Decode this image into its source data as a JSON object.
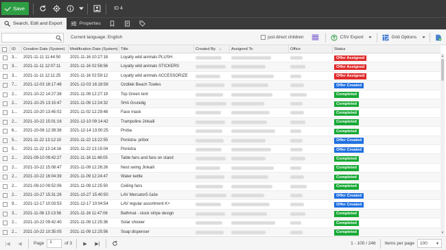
{
  "toolbar": {
    "save_label": "Save",
    "id_label": "ID 4",
    "icons": [
      "refresh-icon",
      "target-icon",
      "info-icon",
      "chevron-down-icon",
      "image-icon"
    ]
  },
  "tabs": [
    {
      "label": "Search, Edit and Export",
      "icon": "search-icon",
      "active": true
    },
    {
      "label": "Properties",
      "icon": "sliders-icon",
      "active": false
    }
  ],
  "filter": {
    "search_value": "",
    "search_placeholder": "",
    "current_language": "Current language: English",
    "direct_children_label": "just direct children",
    "csv_export_label": "CSV Export",
    "grid_options_label": "Grid Options"
  },
  "columns": [
    "ID",
    "Creation Date (System)",
    "Modification Date (System)",
    "Title",
    "Created By",
    "Assigned To",
    "Office",
    "Status"
  ],
  "status_colors": {
    "Offer Assigned": "#e02a2a",
    "Offer Created": "#1f6fe0",
    "Completed": "#17a834"
  },
  "rows": [
    {
      "id": "3...",
      "created": "2021-11-11 11:44:50",
      "modified": "2021-11-16 10:27:18",
      "title": "Loyalty wild animals PLUSH",
      "status": "Offer Assigned"
    },
    {
      "id": "3...",
      "created": "2021-11-11 12:07:11",
      "modified": "2021-11-16 02:58:56",
      "title": "Loyalty wild animals STICKERS",
      "status": "Offer Assigned"
    },
    {
      "id": "3...",
      "created": "2021-11-11 12:11:25",
      "modified": "2021-11-16 02:59:12",
      "title": "Loyalty wild animals ACCESSORIZE",
      "status": "Offer Assigned"
    },
    {
      "id": "7...",
      "created": "2021-12-03 16:17:48",
      "modified": "2021-12-03 16:18:58",
      "title": "Ozdilek Beach Towles",
      "status": "Offer Created"
    },
    {
      "id": "2...",
      "created": "2021-10-22 14:27:38",
      "modified": "2021-11-09 12:27:19",
      "title": "Top Green tent",
      "status": "Completed"
    },
    {
      "id": "2...",
      "created": "2021-10-25 13:15:47",
      "modified": "2021-11-09 12:24:32",
      "title": "SHA Grunidig",
      "status": "Completed"
    },
    {
      "id": "1...",
      "created": "2021-10-20 13:45:02",
      "modified": "2021-11-02 12:29:48",
      "title": "Face mask",
      "status": "Completed"
    },
    {
      "id": "2...",
      "created": "2021-10-22 15:01:16",
      "modified": "2021-12-10 09:14:42",
      "title": "Trampoline Jinkaili",
      "status": "Completed"
    },
    {
      "id": "6...",
      "created": "2021-10-08 12:39:36",
      "modified": "2021-12-14 13:00:25",
      "title": "Proba",
      "status": "Completed"
    },
    {
      "id": "5...",
      "created": "2021-11-22 13:12:10",
      "modified": "2021-11-22 13:22:55",
      "title": "Ponistra- pribor",
      "status": "Offer Created"
    },
    {
      "id": "5...",
      "created": "2021-11-22 13:14:16",
      "modified": "2021-11-22 13:15:04",
      "title": "Ponistra",
      "status": "Offer Created"
    },
    {
      "id": "2...",
      "created": "2021-09-10 09:42:27",
      "modified": "2021-11-16 11:48:05",
      "title": "Table fans and fans on stand",
      "status": "Completed"
    },
    {
      "id": "2...",
      "created": "2021-10-22 15:08:47",
      "modified": "2021-11-09 12:26:26",
      "title": "Nest swing Jinkaili",
      "status": "Completed"
    },
    {
      "id": "2...",
      "created": "2021-10-22 16:04:39",
      "modified": "2021-11-09 12:24:47",
      "title": "Water kettle",
      "status": "Completed"
    },
    {
      "id": "2...",
      "created": "2021-09-10 09:52:06",
      "modified": "2021-11-09 12:25:50",
      "title": "Ceiling fans",
      "status": "Completed"
    },
    {
      "id": "2...",
      "created": "2021-10-27 15:31:26",
      "modified": "2021-10-27 15:40:50",
      "title": "LAV Mercator5 čaše",
      "status": "Offer Created"
    },
    {
      "id": "9...",
      "created": "2021-12-17 10:03:53",
      "modified": "2021-12-17 10:04:54",
      "title": "LAV regular assortment K+",
      "status": "Offer Created"
    },
    {
      "id": "3...",
      "created": "2021-11-08 13:13:56",
      "modified": "2021-11-16 11:47:06",
      "title": "Bathmat - stock stripe design",
      "status": "Completed"
    },
    {
      "id": "2...",
      "created": "2021-10-22 09:42:40",
      "modified": "2021-11-09 12:25:36",
      "title": "Solar shower",
      "status": "Completed"
    },
    {
      "id": "2...",
      "created": "2021-10-22 10:35:05",
      "modified": "2021-11-09 12:25:56",
      "title": "Soap dispenser",
      "status": "Completed"
    }
  ],
  "pager": {
    "page_label": "Page",
    "page_value": "1",
    "of_label": "of 3",
    "range_label": "1 - 100 / 246",
    "per_page_label": "Items per page",
    "per_page_value": "100"
  }
}
